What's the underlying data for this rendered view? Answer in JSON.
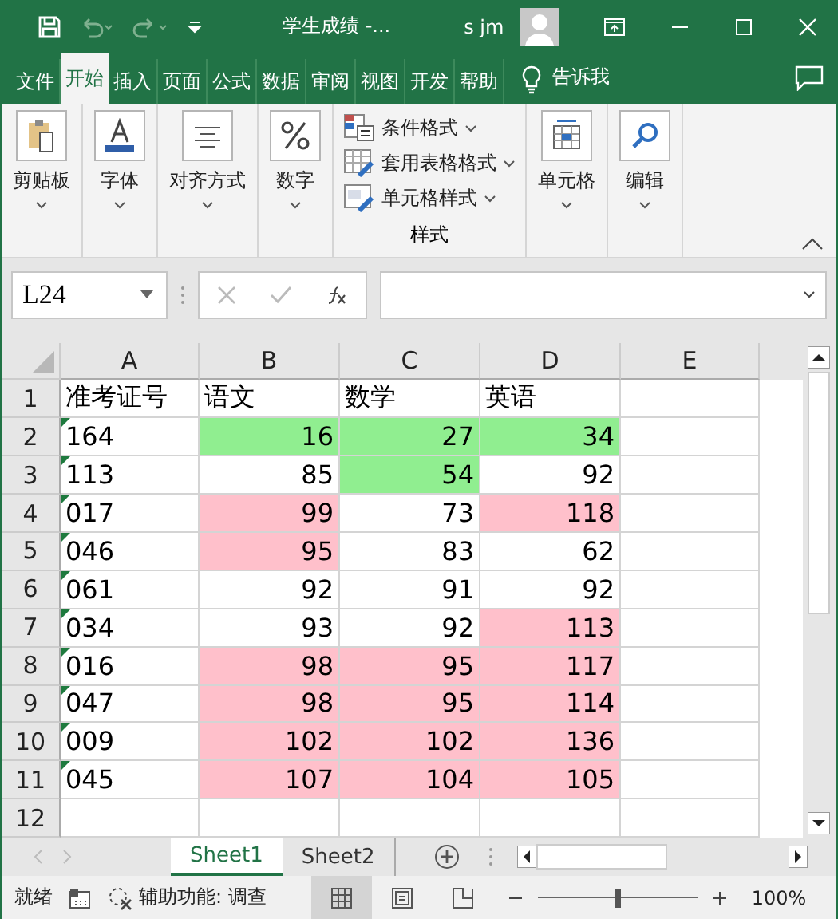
{
  "window": {
    "title": "学生成绩  -...",
    "user": "s jm"
  },
  "tabs": [
    {
      "label": "文件",
      "selected": false
    },
    {
      "label": "开始",
      "selected": true
    },
    {
      "label": "插入",
      "selected": false
    },
    {
      "label": "页面 ",
      "selected": false
    },
    {
      "label": "公式",
      "selected": false
    },
    {
      "label": "数据",
      "selected": false
    },
    {
      "label": "审阅",
      "selected": false
    },
    {
      "label": "视图",
      "selected": false
    },
    {
      "label": "开发",
      "selected": false
    },
    {
      "label": "帮助",
      "selected": false
    }
  ],
  "tell_me": "告诉我",
  "ribbon": {
    "groups": [
      {
        "kind": "big",
        "label": "剪贴板"
      },
      {
        "kind": "big",
        "label": "字体"
      },
      {
        "kind": "big",
        "label": "对齐方式"
      },
      {
        "kind": "big",
        "label": "数字"
      },
      {
        "kind": "list",
        "items": [
          {
            "label": "条件格式"
          },
          {
            "label": "套用表格格式"
          },
          {
            "label": "单元格样式"
          }
        ],
        "label": "样式"
      },
      {
        "kind": "big",
        "label": "单元格"
      },
      {
        "kind": "big",
        "label": "编辑"
      }
    ]
  },
  "name_box": "L24",
  "columns": [
    "A",
    "B",
    "C",
    "D",
    "E"
  ],
  "rows": [
    {
      "num": "1",
      "cells": [
        {
          "text": "准考证号",
          "kind": "text"
        },
        {
          "text": "语文",
          "kind": "text"
        },
        {
          "text": "数学",
          "kind": "text"
        },
        {
          "text": "英语",
          "kind": "text"
        }
      ]
    },
    {
      "num": "2",
      "cells": [
        {
          "text": "164",
          "kind": "text",
          "flag": true
        },
        {
          "text": "16",
          "kind": "number",
          "color": "#90ee90"
        },
        {
          "text": "27",
          "kind": "number",
          "color": "#90ee90"
        },
        {
          "text": "34",
          "kind": "number",
          "color": "#90ee90"
        }
      ]
    },
    {
      "num": "3",
      "cells": [
        {
          "text": "113",
          "kind": "text",
          "flag": true
        },
        {
          "text": "85",
          "kind": "number"
        },
        {
          "text": "54",
          "kind": "number",
          "color": "#90ee90"
        },
        {
          "text": "92",
          "kind": "number"
        }
      ]
    },
    {
      "num": "4",
      "cells": [
        {
          "text": "017",
          "kind": "text",
          "flag": true
        },
        {
          "text": "99",
          "kind": "number",
          "color": "#ffc0cb"
        },
        {
          "text": "73",
          "kind": "number"
        },
        {
          "text": "118",
          "kind": "number",
          "color": "#ffc0cb"
        }
      ]
    },
    {
      "num": "5",
      "cells": [
        {
          "text": "046",
          "kind": "text",
          "flag": true
        },
        {
          "text": "95",
          "kind": "number",
          "color": "#ffc0cb"
        },
        {
          "text": "83",
          "kind": "number"
        },
        {
          "text": "62",
          "kind": "number"
        }
      ]
    },
    {
      "num": "6",
      "cells": [
        {
          "text": "061",
          "kind": "text",
          "flag": true
        },
        {
          "text": "92",
          "kind": "number"
        },
        {
          "text": "91",
          "kind": "number"
        },
        {
          "text": "92",
          "kind": "number"
        }
      ]
    },
    {
      "num": "7",
      "cells": [
        {
          "text": "034",
          "kind": "text",
          "flag": true
        },
        {
          "text": "93",
          "kind": "number"
        },
        {
          "text": "92",
          "kind": "number"
        },
        {
          "text": "113",
          "kind": "number",
          "color": "#ffc0cb"
        }
      ]
    },
    {
      "num": "8",
      "cells": [
        {
          "text": "016",
          "kind": "text",
          "flag": true
        },
        {
          "text": "98",
          "kind": "number",
          "color": "#ffc0cb"
        },
        {
          "text": "95",
          "kind": "number",
          "color": "#ffc0cb"
        },
        {
          "text": "117",
          "kind": "number",
          "color": "#ffc0cb"
        }
      ]
    },
    {
      "num": "9",
      "cells": [
        {
          "text": "047",
          "kind": "text",
          "flag": true
        },
        {
          "text": "98",
          "kind": "number",
          "color": "#ffc0cb"
        },
        {
          "text": "95",
          "kind": "number",
          "color": "#ffc0cb"
        },
        {
          "text": "114",
          "kind": "number",
          "color": "#ffc0cb"
        }
      ]
    },
    {
      "num": "10",
      "cells": [
        {
          "text": "009",
          "kind": "text",
          "flag": true
        },
        {
          "text": "102",
          "kind": "number",
          "color": "#ffc0cb"
        },
        {
          "text": "102",
          "kind": "number",
          "color": "#ffc0cb"
        },
        {
          "text": "136",
          "kind": "number",
          "color": "#ffc0cb"
        }
      ]
    },
    {
      "num": "11",
      "cells": [
        {
          "text": "045",
          "kind": "text",
          "flag": true
        },
        {
          "text": "107",
          "kind": "number",
          "color": "#ffc0cb"
        },
        {
          "text": "104",
          "kind": "number",
          "color": "#ffc0cb"
        },
        {
          "text": "105",
          "kind": "number",
          "color": "#ffc0cb"
        }
      ]
    },
    {
      "num": "12",
      "cells": []
    }
  ],
  "sheets": [
    {
      "label": "Sheet1",
      "selected": true
    },
    {
      "label": "Sheet2",
      "selected": false
    }
  ],
  "status": {
    "ready": "就绪",
    "accessibility": "辅助功能: 调查",
    "views": [
      {
        "kind": "normal",
        "selected": true
      },
      {
        "kind": "layout",
        "selected": false
      },
      {
        "kind": "pagebreak",
        "selected": false
      }
    ],
    "zoom": {
      "level": 0.5,
      "reading": "100%"
    }
  }
}
